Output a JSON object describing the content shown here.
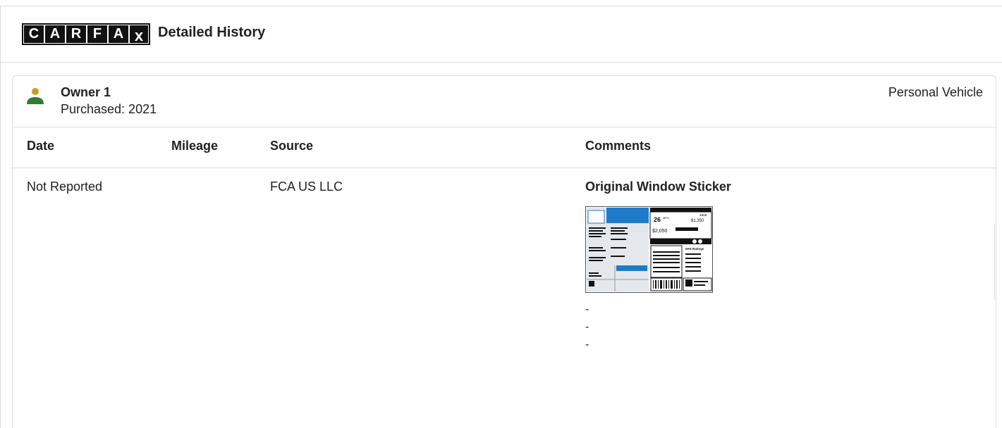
{
  "header": {
    "logo_letters": [
      "C",
      "A",
      "R",
      "F",
      "A",
      "X"
    ],
    "title": "Detailed History"
  },
  "owner": {
    "icon": "person-icon",
    "name": "Owner 1",
    "purchased": "Purchased: 2021",
    "vehicle_type": "Personal Vehicle",
    "icon_colors": {
      "head": "#c8a020",
      "body": "#2e7d32"
    }
  },
  "table": {
    "columns": [
      "Date",
      "Mileage",
      "Source",
      "Comments"
    ],
    "rows": [
      {
        "date": "Not Reported",
        "mileage": "",
        "source": "FCA US LLC",
        "comment_title": "Original Window Sticker",
        "comment_items": [
          "-",
          "-",
          "-"
        ],
        "sticker": {
          "mpg": "26",
          "mpg_unit": "MPG",
          "save_label": "save",
          "save_amount": "$1,350",
          "fuel_cost": "$2,050",
          "ratings_label": "IIHS Ratings"
        }
      }
    ]
  }
}
